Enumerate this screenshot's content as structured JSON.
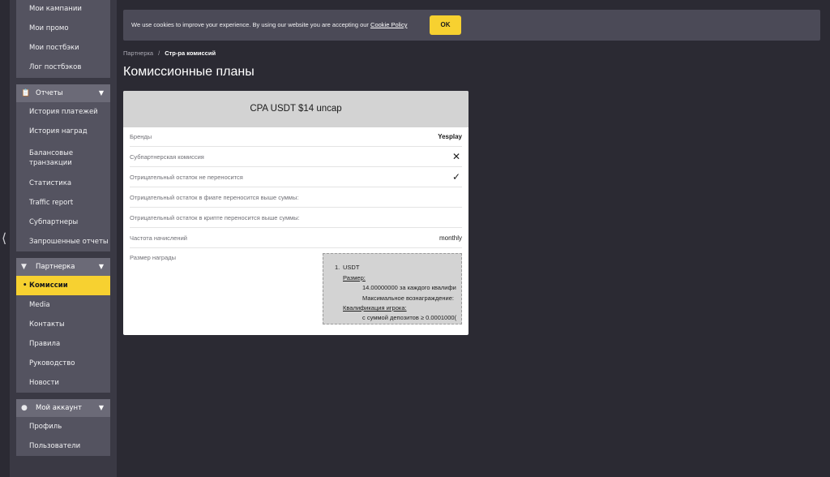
{
  "sidebar": {
    "collapse_icon": "chevron-left-icon",
    "top_items": [
      "Мои кампании",
      "Мои промо",
      "Мои постбэки",
      "Лог постбэков"
    ],
    "groups": [
      {
        "title": "Отчеты",
        "icon": "clipboard-icon",
        "items": [
          "История платежей",
          "История наград",
          "Балансовые транзакции",
          "Статистика",
          "Traffic report",
          "Субпартнеры",
          "Запрошенные отчеты"
        ]
      },
      {
        "title": "Партнерка",
        "icon": "handshake-icon",
        "items": [
          "Комиссии",
          "Media",
          "Контакты",
          "Правила",
          "Руководство",
          "Новости"
        ],
        "active_index": 0
      },
      {
        "title": "Мой аккаунт",
        "icon": "user-icon",
        "items": [
          "Профиль",
          "Пользователи"
        ]
      }
    ]
  },
  "cookie": {
    "text": "We use cookies to improve your experience. By using our website you are accepting our",
    "link": "Cookie Policy",
    "button": "OK"
  },
  "breadcrumb": {
    "parent": "Партнерка",
    "separator": "/",
    "current": "Стр-ра комиссий"
  },
  "page_title": "Комиссионные планы",
  "card": {
    "title": "CPA USDT $14 uncap",
    "rows": [
      {
        "label": "Бренды",
        "value": "Yesplay"
      },
      {
        "label": "Субпартнерская комиссия",
        "value": "✕",
        "icon": "cross-icon"
      },
      {
        "label": "Отрицательный остаток не переносится",
        "value": "✓",
        "icon": "check-icon"
      },
      {
        "label": "Отрицательный остаток в фиате переносится выше суммы:",
        "value": ""
      },
      {
        "label": "Отрицательный остаток в крипте переносится выше суммы:",
        "value": ""
      },
      {
        "label": "Частота начислений",
        "value": "monthly"
      },
      {
        "label": "Размер награды",
        "value": ""
      }
    ],
    "reward": {
      "number": "1.",
      "currency": "USDT",
      "size_label": "Размер:",
      "size_line1": "14.00000000 за каждого квалифи",
      "size_line2": "Максимальное вознаграждение:",
      "qual_label": "Квалификация игрока:",
      "qual_line": "с суммой депозитов ≥ 0.0001000("
    }
  },
  "colors": {
    "background": "#2b2a33",
    "sidebar": "#3a3944",
    "accent": "#f7d130"
  }
}
